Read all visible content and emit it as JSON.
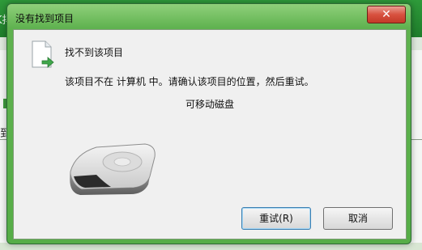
{
  "background": {
    "title_fragment": "K拝",
    "left_fragment": "到"
  },
  "dialog": {
    "title": "没有找到项目",
    "close_glyph": "✕",
    "heading": "找不到该项目",
    "message": "该项目不在 计算机 中。请确认该项目的位置，然后重试。",
    "device_label": "可移动磁盘",
    "icons": [
      "document-arrow-icon",
      "removable-drive-icon"
    ],
    "buttons": {
      "retry": "重试(R)",
      "cancel": "取消"
    }
  },
  "colors": {
    "frame": "#5fb24f",
    "close_button": "#d8513f",
    "client_bg": "#f0f0f0"
  }
}
